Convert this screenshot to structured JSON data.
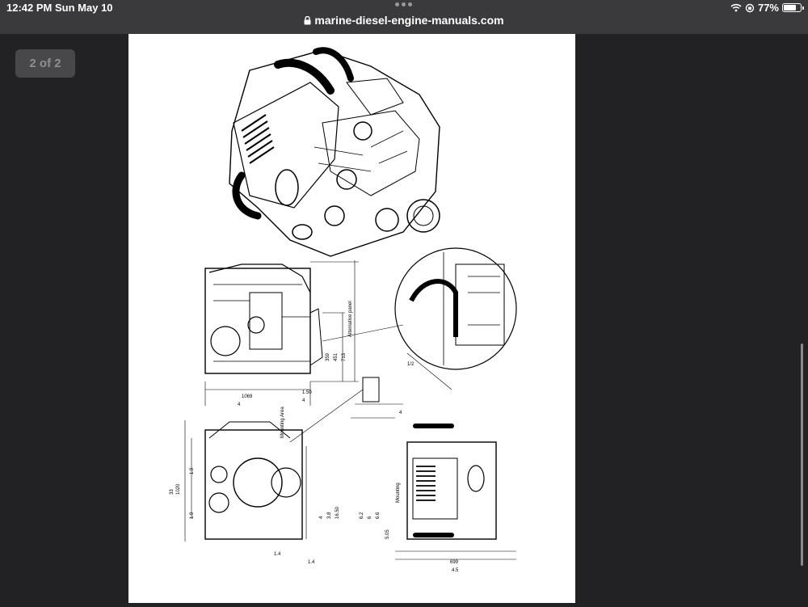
{
  "status_bar": {
    "time": "12:42 PM",
    "date": "Sun May 10",
    "battery_percent": "77%",
    "battery_level": 0.77
  },
  "browser": {
    "url": "marine-diesel-engine-manuals.com"
  },
  "viewer": {
    "page_counter": "2 of 2"
  },
  "drawing": {
    "dimensions_side": [
      "359",
      "451",
      "713",
      "1069",
      "1.50",
      "4",
      "4",
      "4",
      "1/2"
    ],
    "dimensions_lower": [
      "33",
      "1020",
      "1.9",
      "1.9",
      "4",
      "3.8",
      "16.50",
      "6.2",
      "6",
      "6.6",
      "5.05",
      "1.4",
      "1.4"
    ],
    "dimension_bottom_right": "699",
    "dimension_bottom_right_sub": "4.5",
    "vertical_label_side": "Alternative panel",
    "vertical_label_lower": "Mounting Area",
    "vertical_label_right": "Mounting"
  }
}
